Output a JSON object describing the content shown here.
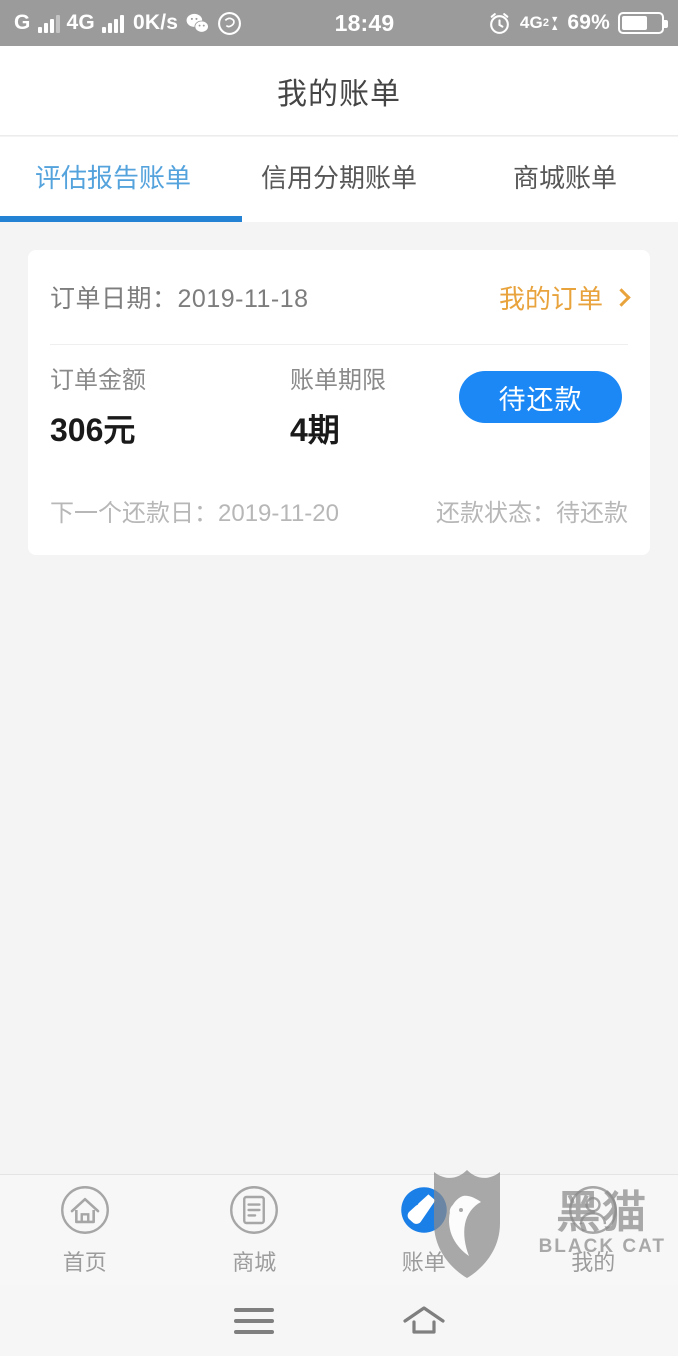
{
  "status_bar": {
    "carrier_g": "G",
    "network": "4G",
    "data_speed": "0K/s",
    "time": "18:49",
    "data_badge": "4G",
    "data_badge_sub": "2",
    "battery_percent": "69%",
    "icons": {
      "signal": "signal-bars-icon",
      "wechat": "wechat-icon",
      "app": "app-icon",
      "alarm": "alarm-clock-icon",
      "battery": "battery-icon"
    }
  },
  "header": {
    "title": "我的账单"
  },
  "tabs": [
    {
      "label": "评估报告账单",
      "active": true
    },
    {
      "label": "信用分期账单",
      "active": false
    },
    {
      "label": "商城账单",
      "active": false
    }
  ],
  "bill_card": {
    "order_date_label": "订单日期：",
    "order_date_value": "2019-11-18",
    "my_orders_link": "我的订单",
    "amount_label": "订单金额",
    "amount_value": "306元",
    "term_label": "账单期限",
    "term_value": "4期",
    "action_button": "待还款",
    "next_repay_label": "下一个还款日：",
    "next_repay_value": "2019-11-20",
    "status_label": "还款状态：",
    "status_value": "待还款"
  },
  "bottom_nav": [
    {
      "label": "首页",
      "icon": "home-icon",
      "active": false
    },
    {
      "label": "商城",
      "icon": "store-icon",
      "active": false
    },
    {
      "label": "账单",
      "icon": "tag-icon",
      "active": true
    },
    {
      "label": "我的",
      "icon": "person-icon",
      "active": false
    }
  ],
  "system_nav": {
    "recents": "recents-icon",
    "home": "home-nav-icon"
  },
  "watermark": {
    "cn": "黑猫",
    "en": "BLACK CAT"
  },
  "colors": {
    "accent_blue": "#1b88f5",
    "tab_active": "#55a3dd",
    "tab_underline": "#2382d4",
    "link_orange": "#e8a33d",
    "page_bg": "#f4f4f4",
    "statusbar_bg": "#9b9b9b"
  }
}
